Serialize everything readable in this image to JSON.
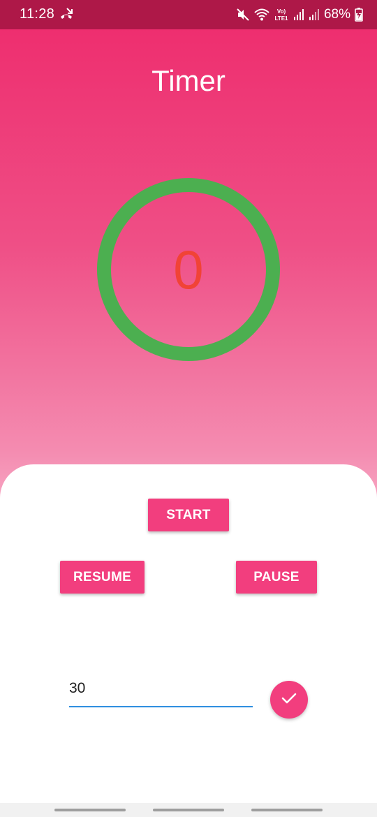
{
  "status_bar": {
    "time": "11:28",
    "battery_percent": "68%",
    "left_icon": "missed-call-icon",
    "right_icons": [
      "mute-icon",
      "wifi-icon",
      "volte-icon",
      "signal-icon",
      "signal-icon-2",
      "battery-charging-icon"
    ],
    "volte_label": "Vo)",
    "lte_label": "LTE1"
  },
  "header": {
    "title": "Timer"
  },
  "timer": {
    "value": "0",
    "ring_color": "#4caf50",
    "value_color": "#f14336"
  },
  "controls": {
    "start_label": "START",
    "resume_label": "RESUME",
    "pause_label": "PAUSE"
  },
  "time_input": {
    "value": "30",
    "confirm_icon": "check-icon"
  },
  "colors": {
    "accent": "#f23e7e",
    "status_bar": "#ae1848",
    "input_underline": "#2f8fe0"
  }
}
